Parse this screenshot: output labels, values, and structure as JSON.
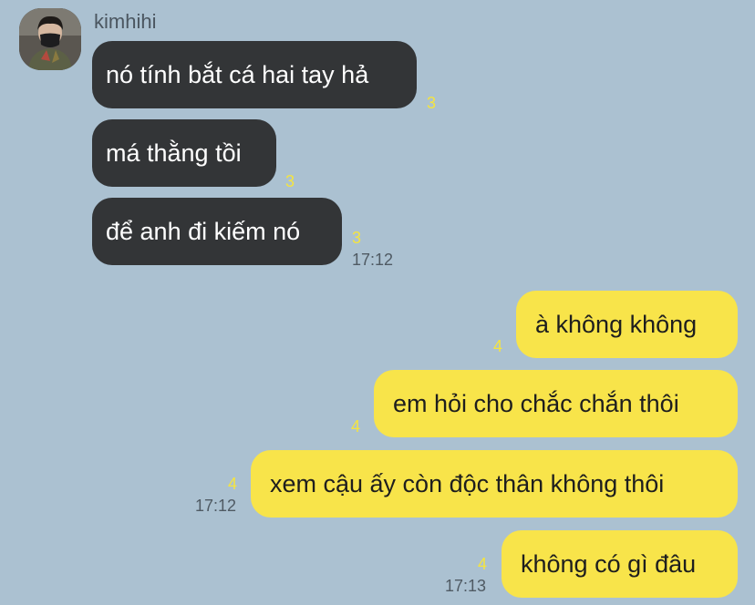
{
  "chat": {
    "sender": "kimhihi",
    "avatar_icon": "person-avatar-icon",
    "colors": {
      "background": "#abc1d1",
      "incoming_bubble": "#333537",
      "outgoing_bubble": "#f8e44a",
      "unread_count": "#f4e440"
    },
    "incoming": [
      {
        "text": "nó tính bắt cá hai tay hả",
        "unread": "3",
        "time": ""
      },
      {
        "text": "má thằng tồi",
        "unread": "3",
        "time": ""
      },
      {
        "text": "để anh đi kiếm nó",
        "unread": "3",
        "time": "17:12"
      }
    ],
    "outgoing": [
      {
        "text": "à không không",
        "unread": "4",
        "time": ""
      },
      {
        "text": "em hỏi cho chắc chắn thôi",
        "unread": "4",
        "time": ""
      },
      {
        "text": "xem cậu ấy còn độc thân không thôi",
        "unread": "4",
        "time": "17:12"
      },
      {
        "text": "không có gì đâu",
        "unread": "4",
        "time": "17:13"
      }
    ]
  }
}
